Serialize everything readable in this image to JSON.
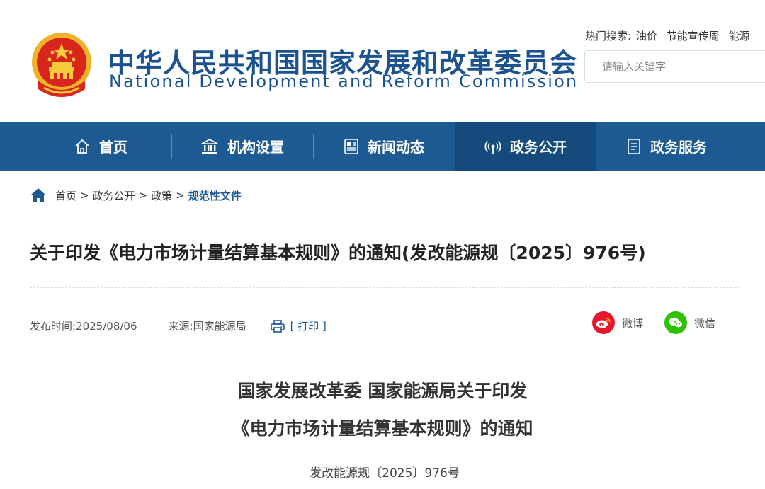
{
  "header": {
    "title_cn": "中华人民共和国国家发展和改革委员会",
    "title_en": "National Development and Reform Commission",
    "hot_search_label": "热门搜索:",
    "hot_search_links": [
      "油价",
      "节能宣传周",
      "能源"
    ],
    "search_placeholder": "请输入关键字"
  },
  "nav": {
    "items": [
      {
        "label": "首页",
        "icon": "home-icon"
      },
      {
        "label": "机构设置",
        "icon": "building-icon"
      },
      {
        "label": "新闻动态",
        "icon": "newspaper-icon"
      },
      {
        "label": "政务公开",
        "icon": "broadcast-icon",
        "active": true
      },
      {
        "label": "政务服务",
        "icon": "document-icon"
      }
    ]
  },
  "breadcrumb": {
    "items": [
      "首页",
      "政务公开",
      "政策"
    ],
    "separator": ">",
    "current": "规范性文件"
  },
  "article": {
    "title": "关于印发《电力市场计量结算基本规则》的通知(发改能源规〔2025〕976号)",
    "publish_label": "发布时间:",
    "publish_date": "2025/08/06",
    "source_label": "来源:",
    "source": "国家能源局",
    "print_label": "[ 打印 ]",
    "share": {
      "weibo": "微博",
      "wechat": "微信"
    }
  },
  "document": {
    "heading_line1": "国家发展改革委 国家能源局关于印发",
    "heading_line2": "《电力市场计量结算基本规则》的通知",
    "number": "发改能源规〔2025〕976号"
  },
  "colors": {
    "brand_blue": "#1d5a91",
    "nav_active": "#154a7c",
    "weibo_red": "#e6162d",
    "wechat_green": "#2dc100"
  }
}
